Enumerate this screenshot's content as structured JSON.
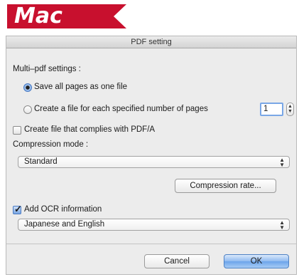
{
  "banner": {
    "text": "Mac",
    "color": "#c8102e"
  },
  "window": {
    "title": "PDF setting"
  },
  "multi_pdf": {
    "heading": "Multi–pdf settings :",
    "option_all": "Save all pages as one file",
    "option_each": "Create a file for each specified number of pages",
    "selected": "option_all",
    "pages_value": "1"
  },
  "pdfa": {
    "label": "Create file that complies with PDF/A",
    "checked": false
  },
  "compression": {
    "heading": "Compression mode :",
    "selected_value": "Standard",
    "rate_button": "Compression rate..."
  },
  "ocr": {
    "label": "Add OCR information",
    "checked": true,
    "language_value": "Japanese and English"
  },
  "footer": {
    "cancel_label": "Cancel",
    "ok_label": "OK"
  },
  "icons": {
    "banner": "mac-banner-icon",
    "select_arrows": "up-down-arrows-icon",
    "stepper": "stepper-icon",
    "checkmark": "checkmark-icon"
  }
}
